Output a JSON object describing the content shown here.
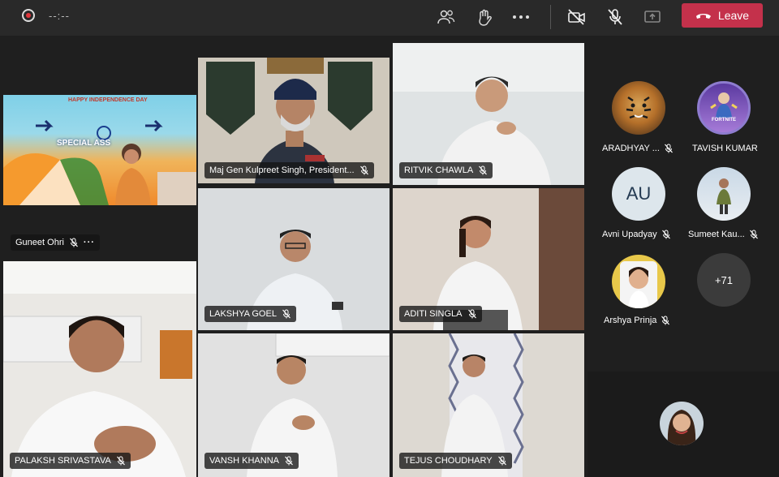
{
  "toolbar": {
    "timer": "--:--",
    "leave_label": "Leave",
    "icons": [
      "people-icon",
      "raise-hand-icon",
      "more-options-icon",
      "camera-off-icon",
      "mic-off-icon",
      "share-screen-icon"
    ],
    "colors": {
      "leave": "#c4314b",
      "bar": "#292929"
    }
  },
  "stage": {
    "presentation": {
      "banner_line1": "HAPPY INDEPENDENCE DAY",
      "banner_line2": "SPECIAL ASS"
    },
    "tiles": [
      {
        "name": "Guneet Ohri"
      },
      {
        "name": "Maj Gen Kulpreet Singh, President..."
      },
      {
        "name": "RITVIK CHAWLA"
      },
      {
        "name": "LAKSHYA GOEL"
      },
      {
        "name": "ADITI SINGLA"
      },
      {
        "name": "PALAKSH SRIVASTAVA"
      },
      {
        "name": "VANSH KHANNA"
      },
      {
        "name": "TEJUS CHOUDHARY"
      }
    ],
    "more_icon": "···"
  },
  "roster": {
    "people": [
      {
        "name": "ARADHYAY ..."
      },
      {
        "name": "TAVISH KUMAR"
      },
      {
        "name": "Avni Upadyay",
        "initials": "AU"
      },
      {
        "name": "Sumeet Kau..."
      },
      {
        "name": "Arshya Prinja"
      }
    ],
    "overflow": "+71",
    "avatar_badge": "FORTNITE"
  }
}
